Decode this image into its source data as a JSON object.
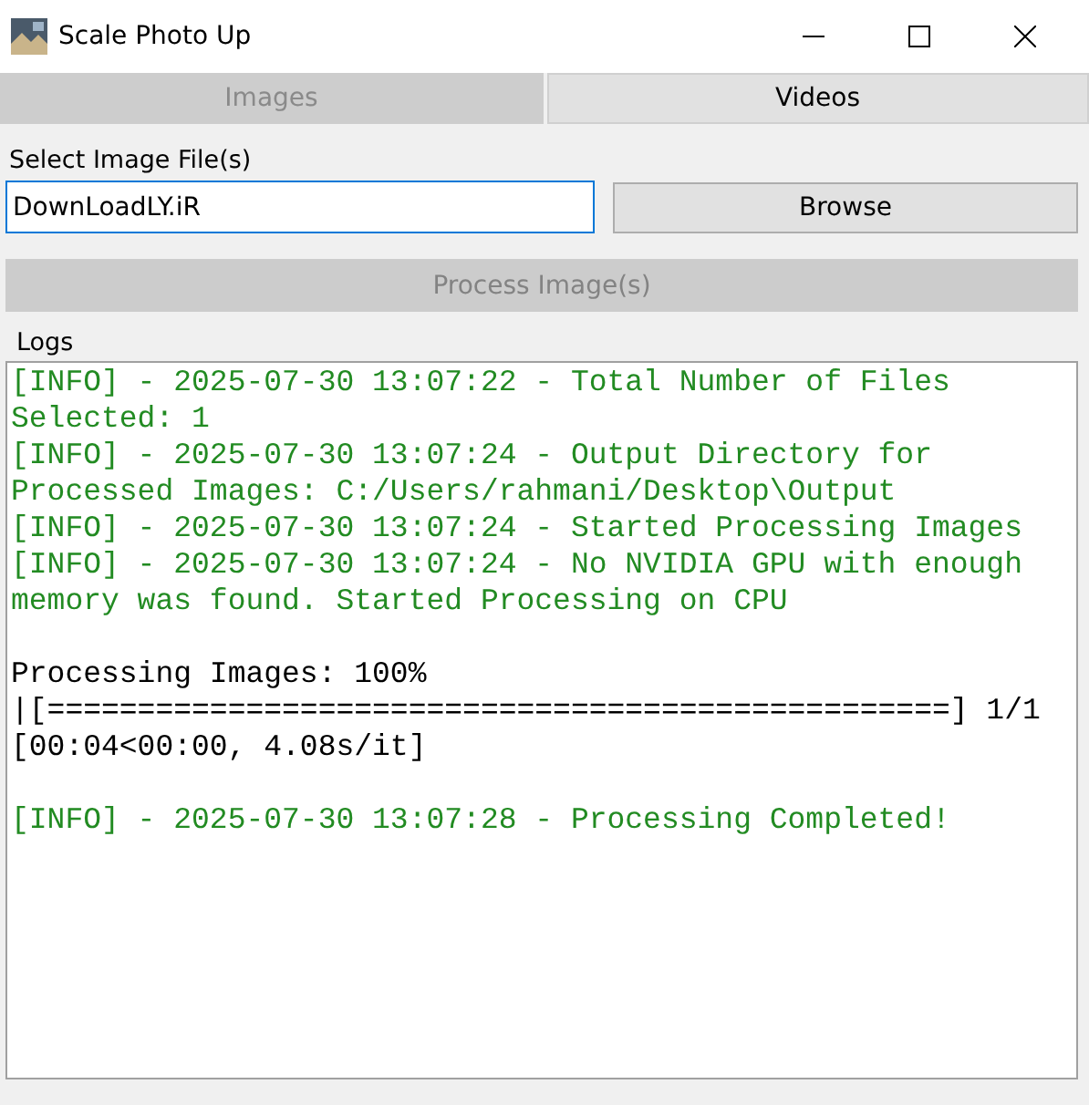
{
  "window": {
    "title": "Scale Photo Up"
  },
  "tabs": [
    {
      "label": "Images",
      "selected": true
    },
    {
      "label": "Videos",
      "selected": false
    }
  ],
  "file_field": {
    "label": "Select Image File(s)",
    "value": "DownLoadLY.iR"
  },
  "browse_button": {
    "label": "Browse",
    "disabled": false
  },
  "process_button": {
    "label": "Process Image(s)",
    "disabled": true
  },
  "logs": {
    "label": "Logs",
    "blocks": [
      {
        "lines": [
          {
            "kind": "info",
            "text": "[INFO] - 2025-07-30 13:07:22 - Total Number of Files Selected: 1"
          },
          {
            "kind": "info",
            "text": "[INFO] - 2025-07-30 13:07:24 - Output Directory for Processed Images: C:/Users/rahmani/Desktop\\Output"
          },
          {
            "kind": "info",
            "text": "[INFO] - 2025-07-30 13:07:24 - Started Processing Images"
          },
          {
            "kind": "info",
            "text": "[INFO] - 2025-07-30 13:07:24 - No NVIDIA GPU with enough memory was found. Started Processing on CPU"
          }
        ]
      },
      {
        "lines": [
          {
            "kind": "plain",
            "text": "Processing Images: 100%"
          },
          {
            "kind": "plain",
            "text": "|[==================================================] 1/1"
          },
          {
            "kind": "plain",
            "text": "[00:04<00:00, 4.08s/it]"
          }
        ]
      },
      {
        "lines": [
          {
            "kind": "info",
            "text": "[INFO] - 2025-07-30 13:07:28 - Processing Completed!"
          }
        ]
      }
    ]
  }
}
